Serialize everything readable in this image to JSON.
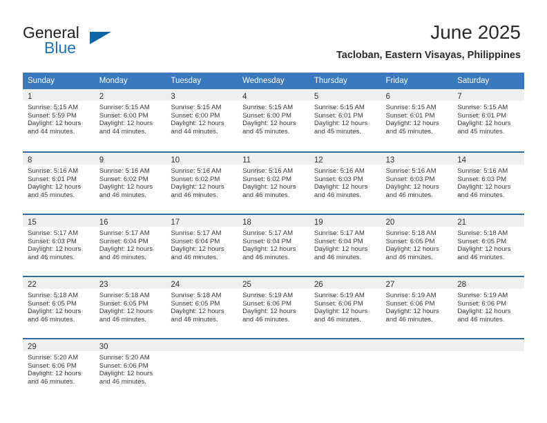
{
  "brand": {
    "name_part1": "General",
    "name_part2": "Blue",
    "accent_color": "#1b72bd",
    "triangle_color": "#1464ab"
  },
  "header": {
    "month_title": "June 2025",
    "location": "Tacloban, Eastern Visayas, Philippines"
  },
  "theme": {
    "header_row_color": "#3b78bd",
    "cell_border_color": "#2e6da4",
    "daynum_band_color": "#efefef",
    "text_color": "#333333"
  },
  "weekday_headers": [
    "Sunday",
    "Monday",
    "Tuesday",
    "Wednesday",
    "Thursday",
    "Friday",
    "Saturday"
  ],
  "weeks": [
    [
      {
        "day": "1",
        "sunrise": "Sunrise: 5:15 AM",
        "sunset": "Sunset: 5:59 PM",
        "daylight1": "Daylight: 12 hours",
        "daylight2": "and 44 minutes."
      },
      {
        "day": "2",
        "sunrise": "Sunrise: 5:15 AM",
        "sunset": "Sunset: 6:00 PM",
        "daylight1": "Daylight: 12 hours",
        "daylight2": "and 44 minutes."
      },
      {
        "day": "3",
        "sunrise": "Sunrise: 5:15 AM",
        "sunset": "Sunset: 6:00 PM",
        "daylight1": "Daylight: 12 hours",
        "daylight2": "and 44 minutes."
      },
      {
        "day": "4",
        "sunrise": "Sunrise: 5:15 AM",
        "sunset": "Sunset: 6:00 PM",
        "daylight1": "Daylight: 12 hours",
        "daylight2": "and 45 minutes."
      },
      {
        "day": "5",
        "sunrise": "Sunrise: 5:15 AM",
        "sunset": "Sunset: 6:01 PM",
        "daylight1": "Daylight: 12 hours",
        "daylight2": "and 45 minutes."
      },
      {
        "day": "6",
        "sunrise": "Sunrise: 5:15 AM",
        "sunset": "Sunset: 6:01 PM",
        "daylight1": "Daylight: 12 hours",
        "daylight2": "and 45 minutes."
      },
      {
        "day": "7",
        "sunrise": "Sunrise: 5:15 AM",
        "sunset": "Sunset: 6:01 PM",
        "daylight1": "Daylight: 12 hours",
        "daylight2": "and 45 minutes."
      }
    ],
    [
      {
        "day": "8",
        "sunrise": "Sunrise: 5:16 AM",
        "sunset": "Sunset: 6:01 PM",
        "daylight1": "Daylight: 12 hours",
        "daylight2": "and 45 minutes."
      },
      {
        "day": "9",
        "sunrise": "Sunrise: 5:16 AM",
        "sunset": "Sunset: 6:02 PM",
        "daylight1": "Daylight: 12 hours",
        "daylight2": "and 46 minutes."
      },
      {
        "day": "10",
        "sunrise": "Sunrise: 5:16 AM",
        "sunset": "Sunset: 6:02 PM",
        "daylight1": "Daylight: 12 hours",
        "daylight2": "and 46 minutes."
      },
      {
        "day": "11",
        "sunrise": "Sunrise: 5:16 AM",
        "sunset": "Sunset: 6:02 PM",
        "daylight1": "Daylight: 12 hours",
        "daylight2": "and 46 minutes."
      },
      {
        "day": "12",
        "sunrise": "Sunrise: 5:16 AM",
        "sunset": "Sunset: 6:03 PM",
        "daylight1": "Daylight: 12 hours",
        "daylight2": "and 46 minutes."
      },
      {
        "day": "13",
        "sunrise": "Sunrise: 5:16 AM",
        "sunset": "Sunset: 6:03 PM",
        "daylight1": "Daylight: 12 hours",
        "daylight2": "and 46 minutes."
      },
      {
        "day": "14",
        "sunrise": "Sunrise: 5:16 AM",
        "sunset": "Sunset: 6:03 PM",
        "daylight1": "Daylight: 12 hours",
        "daylight2": "and 46 minutes."
      }
    ],
    [
      {
        "day": "15",
        "sunrise": "Sunrise: 5:17 AM",
        "sunset": "Sunset: 6:03 PM",
        "daylight1": "Daylight: 12 hours",
        "daylight2": "and 46 minutes."
      },
      {
        "day": "16",
        "sunrise": "Sunrise: 5:17 AM",
        "sunset": "Sunset: 6:04 PM",
        "daylight1": "Daylight: 12 hours",
        "daylight2": "and 46 minutes."
      },
      {
        "day": "17",
        "sunrise": "Sunrise: 5:17 AM",
        "sunset": "Sunset: 6:04 PM",
        "daylight1": "Daylight: 12 hours",
        "daylight2": "and 46 minutes."
      },
      {
        "day": "18",
        "sunrise": "Sunrise: 5:17 AM",
        "sunset": "Sunset: 6:04 PM",
        "daylight1": "Daylight: 12 hours",
        "daylight2": "and 46 minutes."
      },
      {
        "day": "19",
        "sunrise": "Sunrise: 5:17 AM",
        "sunset": "Sunset: 6:04 PM",
        "daylight1": "Daylight: 12 hours",
        "daylight2": "and 46 minutes."
      },
      {
        "day": "20",
        "sunrise": "Sunrise: 5:18 AM",
        "sunset": "Sunset: 6:05 PM",
        "daylight1": "Daylight: 12 hours",
        "daylight2": "and 46 minutes."
      },
      {
        "day": "21",
        "sunrise": "Sunrise: 5:18 AM",
        "sunset": "Sunset: 6:05 PM",
        "daylight1": "Daylight: 12 hours",
        "daylight2": "and 46 minutes."
      }
    ],
    [
      {
        "day": "22",
        "sunrise": "Sunrise: 5:18 AM",
        "sunset": "Sunset: 6:05 PM",
        "daylight1": "Daylight: 12 hours",
        "daylight2": "and 46 minutes."
      },
      {
        "day": "23",
        "sunrise": "Sunrise: 5:18 AM",
        "sunset": "Sunset: 6:05 PM",
        "daylight1": "Daylight: 12 hours",
        "daylight2": "and 46 minutes."
      },
      {
        "day": "24",
        "sunrise": "Sunrise: 5:18 AM",
        "sunset": "Sunset: 6:05 PM",
        "daylight1": "Daylight: 12 hours",
        "daylight2": "and 46 minutes."
      },
      {
        "day": "25",
        "sunrise": "Sunrise: 5:19 AM",
        "sunset": "Sunset: 6:06 PM",
        "daylight1": "Daylight: 12 hours",
        "daylight2": "and 46 minutes."
      },
      {
        "day": "26",
        "sunrise": "Sunrise: 5:19 AM",
        "sunset": "Sunset: 6:06 PM",
        "daylight1": "Daylight: 12 hours",
        "daylight2": "and 46 minutes."
      },
      {
        "day": "27",
        "sunrise": "Sunrise: 5:19 AM",
        "sunset": "Sunset: 6:06 PM",
        "daylight1": "Daylight: 12 hours",
        "daylight2": "and 46 minutes."
      },
      {
        "day": "28",
        "sunrise": "Sunrise: 5:19 AM",
        "sunset": "Sunset: 6:06 PM",
        "daylight1": "Daylight: 12 hours",
        "daylight2": "and 46 minutes."
      }
    ],
    [
      {
        "day": "29",
        "sunrise": "Sunrise: 5:20 AM",
        "sunset": "Sunset: 6:06 PM",
        "daylight1": "Daylight: 12 hours",
        "daylight2": "and 46 minutes."
      },
      {
        "day": "30",
        "sunrise": "Sunrise: 5:20 AM",
        "sunset": "Sunset: 6:06 PM",
        "daylight1": "Daylight: 12 hours",
        "daylight2": "and 46 minutes."
      },
      {
        "day": "",
        "sunrise": "",
        "sunset": "",
        "daylight1": "",
        "daylight2": ""
      },
      {
        "day": "",
        "sunrise": "",
        "sunset": "",
        "daylight1": "",
        "daylight2": ""
      },
      {
        "day": "",
        "sunrise": "",
        "sunset": "",
        "daylight1": "",
        "daylight2": ""
      },
      {
        "day": "",
        "sunrise": "",
        "sunset": "",
        "daylight1": "",
        "daylight2": ""
      },
      {
        "day": "",
        "sunrise": "",
        "sunset": "",
        "daylight1": "",
        "daylight2": ""
      }
    ]
  ]
}
